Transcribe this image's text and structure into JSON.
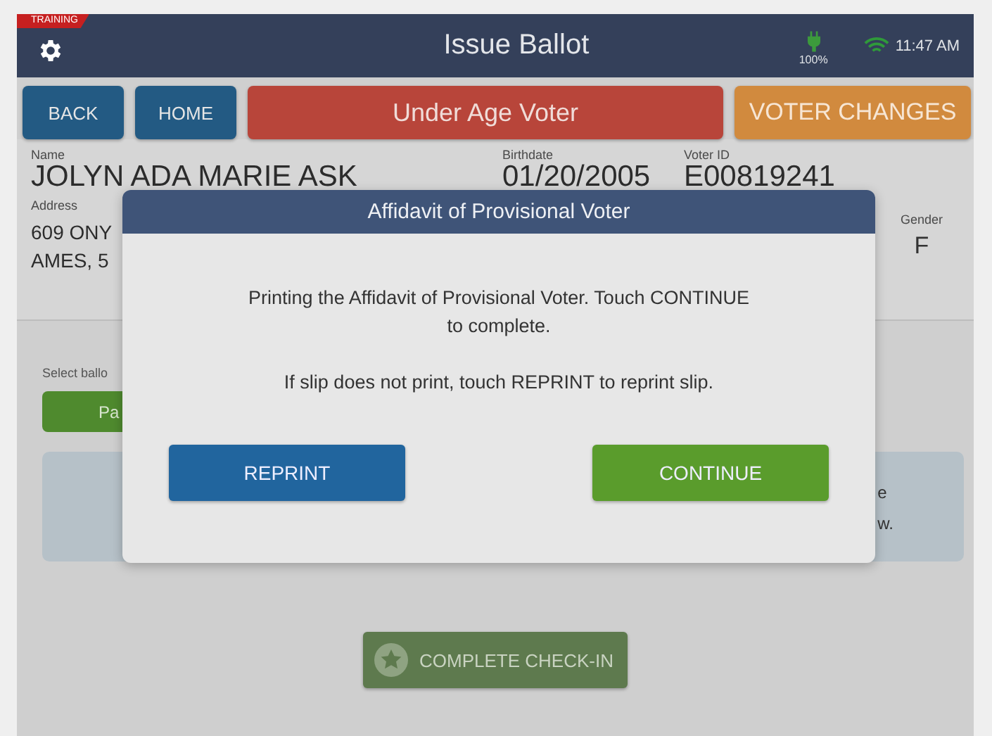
{
  "training_badge": "TRAINING",
  "header": {
    "title": "Issue Ballot",
    "battery": "100%",
    "time": "11:47 AM"
  },
  "toolbar": [
    {
      "label": "BACK",
      "kind": "nav"
    },
    {
      "label": "HOME",
      "kind": "nav"
    },
    {
      "label": "Under Age Voter",
      "kind": "alert"
    },
    {
      "label": "VOTER CHANGES",
      "kind": "warn"
    }
  ],
  "voter": {
    "name_label": "Name",
    "name": "JOLYN ADA MARIE ASK",
    "birthdate_label": "Birthdate",
    "birthdate": "01/20/2005",
    "voter_id_label": "Voter ID",
    "voter_id": "E00819241",
    "address_label": "Address",
    "address_lines": [
      "609 ONY",
      "AMES, 5"
    ],
    "gender_label": "Gender",
    "gender": "F"
  },
  "ballot": {
    "label": "Select ballo",
    "button": "Pa"
  },
  "notice": {
    "lines": [
      "e",
      "w."
    ]
  },
  "complete_button": "COMPLETE CHECK-IN",
  "dialog": {
    "title": "Affidavit of Provisional Voter",
    "messages": [
      "Printing the Affidavit of Provisional Voter. Touch CONTINUE to complete.",
      "If slip does not print, touch REPRINT to reprint slip."
    ],
    "buttons": [
      {
        "label": "REPRINT",
        "kind": "secondary"
      },
      {
        "label": "CONTINUE",
        "kind": "primary"
      }
    ]
  }
}
